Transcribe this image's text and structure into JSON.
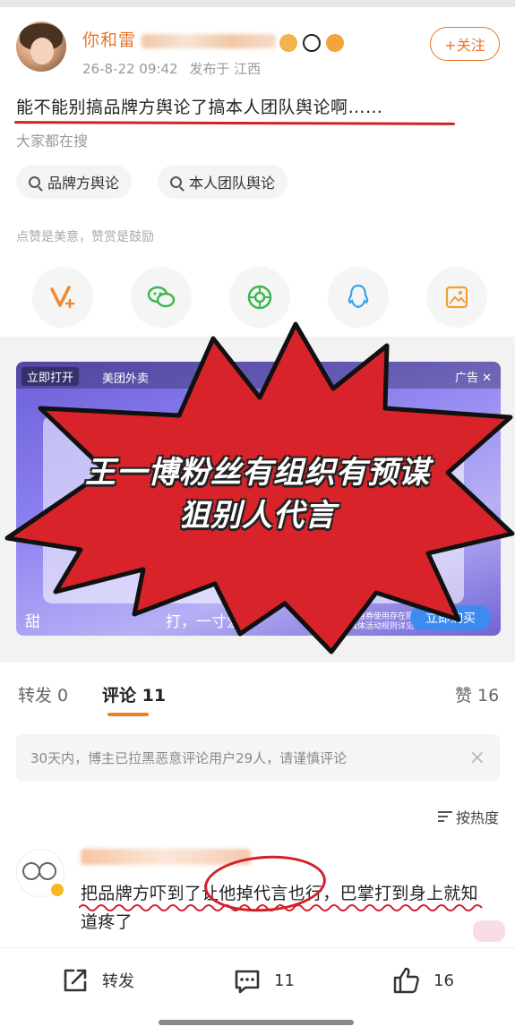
{
  "post": {
    "username": "你和雷",
    "time": "26-8-22 09:42",
    "location": "发布于 江西",
    "follow_label": "+关注",
    "text": "能不能别搞品牌方舆论了搞本人团队舆论啊……",
    "search_hint": "大家都在搜",
    "tags": [
      "品牌方舆论",
      "本人团队舆论"
    ],
    "like_hint": "点赞是美意，赞赏是鼓励",
    "share_icons": [
      "v-reward-icon",
      "wechat-icon",
      "moments-icon",
      "qq-icon",
      "save-image-icon"
    ]
  },
  "ad": {
    "open_label": "立即打开",
    "brand": "美团外卖",
    "ad_label": "广告",
    "bottom_text": "甜",
    "bottom_text_2": "打，一寸爱了",
    "small_text": "优惠券使用存在限制 具体活动规则详见",
    "cta": "立即购买"
  },
  "overlay": {
    "line1": "王一博粉丝有组织有预谋",
    "line2": "狙别人代言",
    "color": "#d8232a"
  },
  "stats": {
    "repost": "转发 0",
    "comments": "评论 11",
    "likes": "赞 16"
  },
  "notice": {
    "text": "30天内，博主已拉黑恶意评论用户29人，请谨慎评论",
    "close": "×"
  },
  "sort": {
    "label": "按热度"
  },
  "comment": {
    "text": "把品牌方吓到了让他掉代言也行，巴掌打到身上就知道疼了"
  },
  "bottom_bar": {
    "repost": "转发",
    "comment_count": "11",
    "like_count": "16"
  },
  "colors": {
    "accent": "#e8752a",
    "red": "#d0202a"
  }
}
